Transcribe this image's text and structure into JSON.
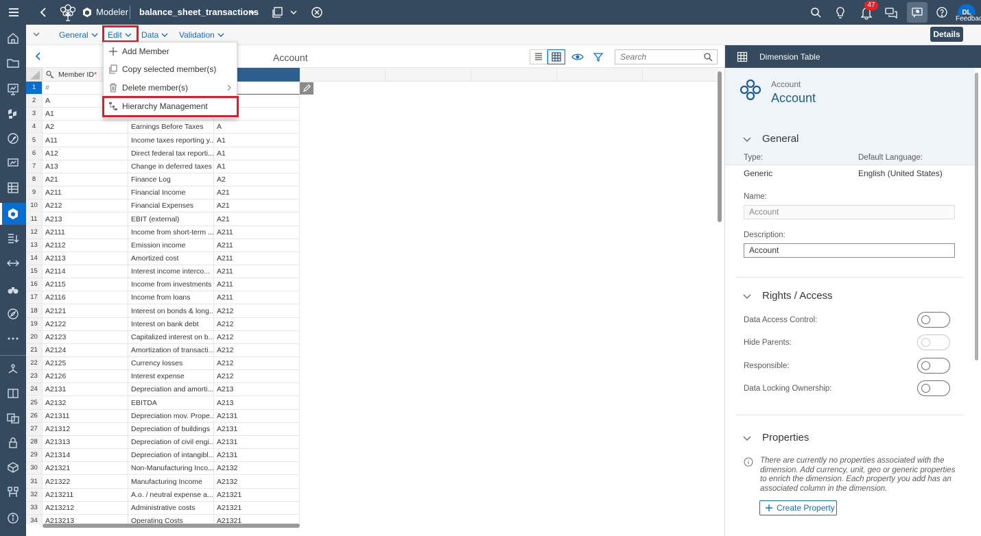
{
  "shell": {
    "app_label": "Modeler",
    "model_name": "balance_sheet_transactions",
    "notifications_count": "47",
    "avatar_initials": "DL",
    "feedback_label": "Feedback"
  },
  "toolbar": {
    "menus": [
      "General",
      "Edit",
      "Data",
      "Validation"
    ],
    "details_label": "Details"
  },
  "edit_menu": {
    "items": [
      "Add Member",
      "Copy selected member(s)",
      "Delete member(s)",
      "Hierarchy Management"
    ]
  },
  "grid": {
    "title": "Account",
    "search_placeholder": "Search",
    "column_member_id": "Member ID",
    "required_mark": "*",
    "rows": [
      {
        "n": "1",
        "id": "#",
        "desc": "",
        "parent": ""
      },
      {
        "n": "2",
        "id": "A",
        "desc": "",
        "parent": ""
      },
      {
        "n": "3",
        "id": "A1",
        "desc": "",
        "parent": ""
      },
      {
        "n": "4",
        "id": "A2",
        "desc": "Earnings Before Taxes",
        "parent": "A"
      },
      {
        "n": "5",
        "id": "A11",
        "desc": "Income taxes reporting y...",
        "parent": "A1"
      },
      {
        "n": "6",
        "id": "A12",
        "desc": "Direct federal tax reporti...",
        "parent": "A1"
      },
      {
        "n": "7",
        "id": "A13",
        "desc": "Change in deferred taxes",
        "parent": "A1"
      },
      {
        "n": "8",
        "id": "A21",
        "desc": "Finance Log",
        "parent": "A2"
      },
      {
        "n": "9",
        "id": "A211",
        "desc": "Financial Income",
        "parent": "A21"
      },
      {
        "n": "10",
        "id": "A212",
        "desc": "Financial Expenses",
        "parent": "A21"
      },
      {
        "n": "11",
        "id": "A213",
        "desc": "EBIT (external)",
        "parent": "A21"
      },
      {
        "n": "12",
        "id": "A2111",
        "desc": "Income from short-term ...",
        "parent": "A211"
      },
      {
        "n": "13",
        "id": "A2112",
        "desc": "Emission income",
        "parent": "A211"
      },
      {
        "n": "14",
        "id": "A2113",
        "desc": "Amortized cost",
        "parent": "A211"
      },
      {
        "n": "15",
        "id": "A2114",
        "desc": "Interest income interco...",
        "parent": "A211"
      },
      {
        "n": "16",
        "id": "A2115",
        "desc": "Income from investments",
        "parent": "A211"
      },
      {
        "n": "17",
        "id": "A2116",
        "desc": "Income from loans",
        "parent": "A211"
      },
      {
        "n": "18",
        "id": "A2121",
        "desc": "Interest on bonds & long...",
        "parent": "A212"
      },
      {
        "n": "19",
        "id": "A2122",
        "desc": "Interest on bank debt",
        "parent": "A212"
      },
      {
        "n": "20",
        "id": "A2123",
        "desc": "Capitalized interest on b...",
        "parent": "A212"
      },
      {
        "n": "21",
        "id": "A2124",
        "desc": "Amortization of transacti...",
        "parent": "A212"
      },
      {
        "n": "22",
        "id": "A2125",
        "desc": "Currency losses",
        "parent": "A212"
      },
      {
        "n": "23",
        "id": "A2126",
        "desc": "Interest expense",
        "parent": "A212"
      },
      {
        "n": "24",
        "id": "A2131",
        "desc": "Depreciation and amorti...",
        "parent": "A213"
      },
      {
        "n": "25",
        "id": "A2132",
        "desc": "EBITDA",
        "parent": "A213"
      },
      {
        "n": "26",
        "id": "A21311",
        "desc": "Depreciation mov. Prope...",
        "parent": "A2131"
      },
      {
        "n": "27",
        "id": "A21312",
        "desc": "Depreciation of buildings",
        "parent": "A2131"
      },
      {
        "n": "28",
        "id": "A21313",
        "desc": "Depreciation of civil engi...",
        "parent": "A2131"
      },
      {
        "n": "29",
        "id": "A21314",
        "desc": "Depreciation of intangibl...",
        "parent": "A2131"
      },
      {
        "n": "30",
        "id": "A21321",
        "desc": "Non-Manufacturing Inco...",
        "parent": "A2132"
      },
      {
        "n": "31",
        "id": "A21322",
        "desc": "Manufacturing Income",
        "parent": "A2132"
      },
      {
        "n": "32",
        "id": "A213211",
        "desc": "A.o. / neutral expense a...",
        "parent": "A21321"
      },
      {
        "n": "33",
        "id": "A213212",
        "desc": "Administrative costs",
        "parent": "A21321"
      },
      {
        "n": "34",
        "id": "A213213",
        "desc": "Operating Costs",
        "parent": "A21321"
      }
    ]
  },
  "panel": {
    "header_title": "Dimension Table",
    "card_small": "Account",
    "card_big": "Account",
    "general": {
      "title": "General",
      "type_label": "Type:",
      "type_value": "Generic",
      "lang_label": "Default Language:",
      "lang_value": "English (United States)",
      "name_label": "Name:",
      "name_value": "Account",
      "desc_label": "Description:",
      "desc_value": "Account"
    },
    "rights": {
      "title": "Rights / Access",
      "items": [
        "Data Access Control:",
        "Hide Parents:",
        "Responsible:",
        "Data Locking Ownership:"
      ]
    },
    "properties": {
      "title": "Properties",
      "info": "There are currently no properties associated with the dimension. Add currency, unit, geo or generic properties to enrich the dimension. Each property you add has an associated column in the dimension.",
      "create_label": "Create Property"
    }
  },
  "colors": {
    "shell": "#354a5f",
    "accent": "#0a6ed1",
    "highlight": "#e01b2e",
    "badge": "#e4242a"
  }
}
